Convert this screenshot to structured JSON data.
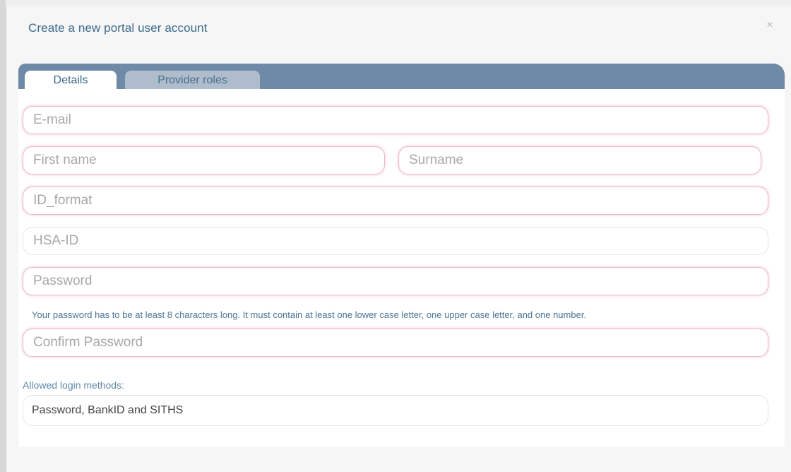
{
  "modal": {
    "title": "Create a new portal user account",
    "close_symbol": "×"
  },
  "tabs": [
    {
      "label": "Details",
      "active": true
    },
    {
      "label": "Provider roles",
      "active": false
    }
  ],
  "form": {
    "email": {
      "placeholder": "E-mail",
      "value": ""
    },
    "first_name": {
      "placeholder": "First name",
      "value": ""
    },
    "surname": {
      "placeholder": "Surname",
      "value": ""
    },
    "id_format": {
      "placeholder": "ID_format",
      "value": ""
    },
    "hsa_id": {
      "placeholder": "HSA-ID",
      "value": ""
    },
    "password": {
      "placeholder": "Password",
      "value": ""
    },
    "password_hint": "Your password has to be at least 8 characters long. It must contain at least one lower case letter, one upper case letter, and one number.",
    "confirm_password": {
      "placeholder": "Confirm Password",
      "value": ""
    },
    "login_methods_label": "Allowed login methods:",
    "login_methods_value": "Password, BankID and SITHS"
  },
  "colors": {
    "title": "#3d6a8a",
    "tab_strip": "#6e8aa6",
    "invalid_border": "#f0b8c4"
  }
}
